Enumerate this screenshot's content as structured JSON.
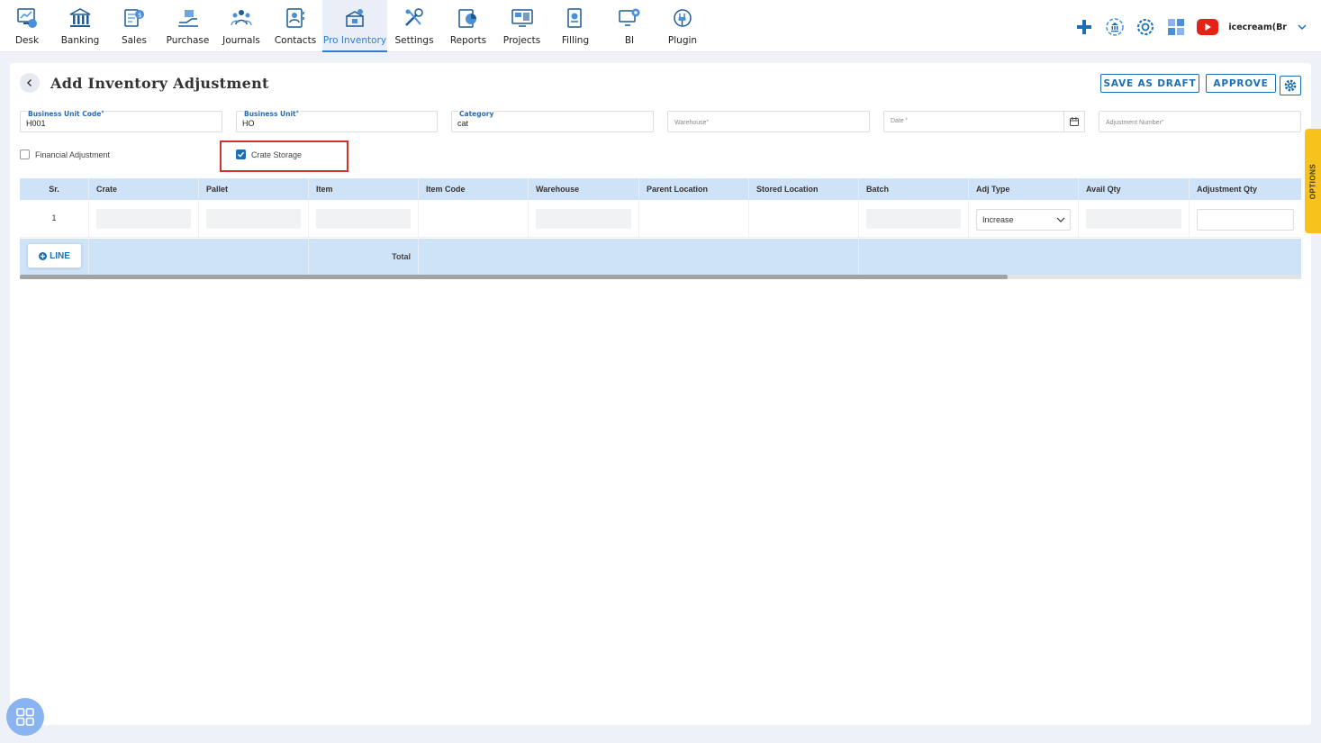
{
  "nav": {
    "items": [
      {
        "label": "Desk",
        "icon": "desk-icon"
      },
      {
        "label": "Banking",
        "icon": "bank-icon"
      },
      {
        "label": "Sales",
        "icon": "sales-icon"
      },
      {
        "label": "Purchase",
        "icon": "purchase-icon"
      },
      {
        "label": "Journals",
        "icon": "journals-icon"
      },
      {
        "label": "Contacts",
        "icon": "contacts-icon"
      },
      {
        "label": "Pro Inventory",
        "icon": "inventory-icon",
        "active": true
      },
      {
        "label": "Settings",
        "icon": "settings-tools-icon"
      },
      {
        "label": "Reports",
        "icon": "reports-icon"
      },
      {
        "label": "Projects",
        "icon": "projects-icon"
      },
      {
        "label": "Filling",
        "icon": "filling-icon"
      },
      {
        "label": "BI",
        "icon": "bi-icon"
      },
      {
        "label": "Plugin",
        "icon": "plugin-icon"
      }
    ],
    "company": "icecream(Br",
    "accent": "#2f7dd1"
  },
  "page": {
    "title": "Add Inventory Adjustment",
    "save_draft_label": "SAVE AS DRAFT",
    "approve_label": "APPROVE"
  },
  "form": {
    "business_unit_code": {
      "label": "Business Unit Code",
      "value": "H001"
    },
    "business_unit": {
      "label": "Business Unit",
      "value": "HO"
    },
    "category": {
      "label": "Category",
      "value": "cat"
    },
    "warehouse": {
      "placeholder": "Warehouse"
    },
    "date": {
      "placeholder": "Date"
    },
    "adjustment_number": {
      "placeholder": "Adjustment Number"
    },
    "financial_adjustment": {
      "label": "Financial Adjustment",
      "checked": false
    },
    "crate_storage": {
      "label": "Crate Storage",
      "checked": true
    }
  },
  "table": {
    "headers": [
      "Sr.",
      "Crate",
      "Pallet",
      "Item",
      "Item Code",
      "Warehouse",
      "Parent Location",
      "Stored Location",
      "Batch",
      "Adj Type",
      "Avail Qty",
      "Adjustment Qty"
    ],
    "rows": [
      {
        "sr": "1",
        "adj_type": "Increase"
      }
    ],
    "add_line_label": "LINE",
    "total_label": "Total"
  },
  "options_label": "OPTIONS",
  "colors": {
    "primary": "#1d6fb5",
    "table_header": "#cfe3f8",
    "highlight": "#d32f2f",
    "options_tab": "#f7c21c"
  }
}
